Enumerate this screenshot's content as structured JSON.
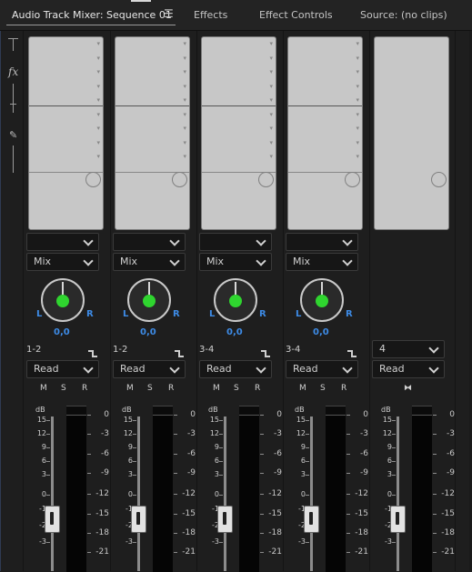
{
  "tabs": [
    {
      "label": "Audio Track Mixer: Sequence 01",
      "active": true
    },
    {
      "label": "Effects"
    },
    {
      "label": "Effect Controls"
    },
    {
      "label": "Source: (no clips)"
    }
  ],
  "panel_menu_icon": "hamburger-icon",
  "left_strip": {
    "fx_label": "fx"
  },
  "tracks": [
    {
      "effect_dropdown": "",
      "send": "Mix",
      "pan_l": "L",
      "pan_r": "R",
      "pan_value": "0,0",
      "route": "1-2",
      "automation": "Read",
      "m": "M",
      "s": "S",
      "r": "R"
    },
    {
      "effect_dropdown": "",
      "send": "Mix",
      "pan_l": "L",
      "pan_r": "R",
      "pan_value": "0,0",
      "route": "1-2",
      "automation": "Read",
      "m": "M",
      "s": "S",
      "r": "R"
    },
    {
      "effect_dropdown": "",
      "send": "Mix",
      "pan_l": "L",
      "pan_r": "R",
      "pan_value": "0,0",
      "route": "3-4",
      "automation": "Read",
      "m": "M",
      "s": "S",
      "r": "R"
    },
    {
      "effect_dropdown": "",
      "send": "Mix",
      "pan_l": "L",
      "pan_r": "R",
      "pan_value": "0,0",
      "route": "3-4",
      "automation": "Read",
      "m": "M",
      "s": "S",
      "r": "R"
    }
  ],
  "master": {
    "channels": "4",
    "automation": "Read",
    "icon": "bowtie-icon"
  },
  "fader_scale": {
    "db_label": "dB",
    "ticks": [
      "15",
      "12",
      "9",
      "6",
      "3",
      "0",
      "-1",
      "-2",
      "-3"
    ]
  },
  "meter_scale": [
    "0",
    "-3",
    "-6",
    "-9",
    "-12",
    "-15",
    "-18",
    "-21"
  ],
  "colors": {
    "pan_label": "#3d8be6",
    "pan_dot": "#2fd52f"
  }
}
